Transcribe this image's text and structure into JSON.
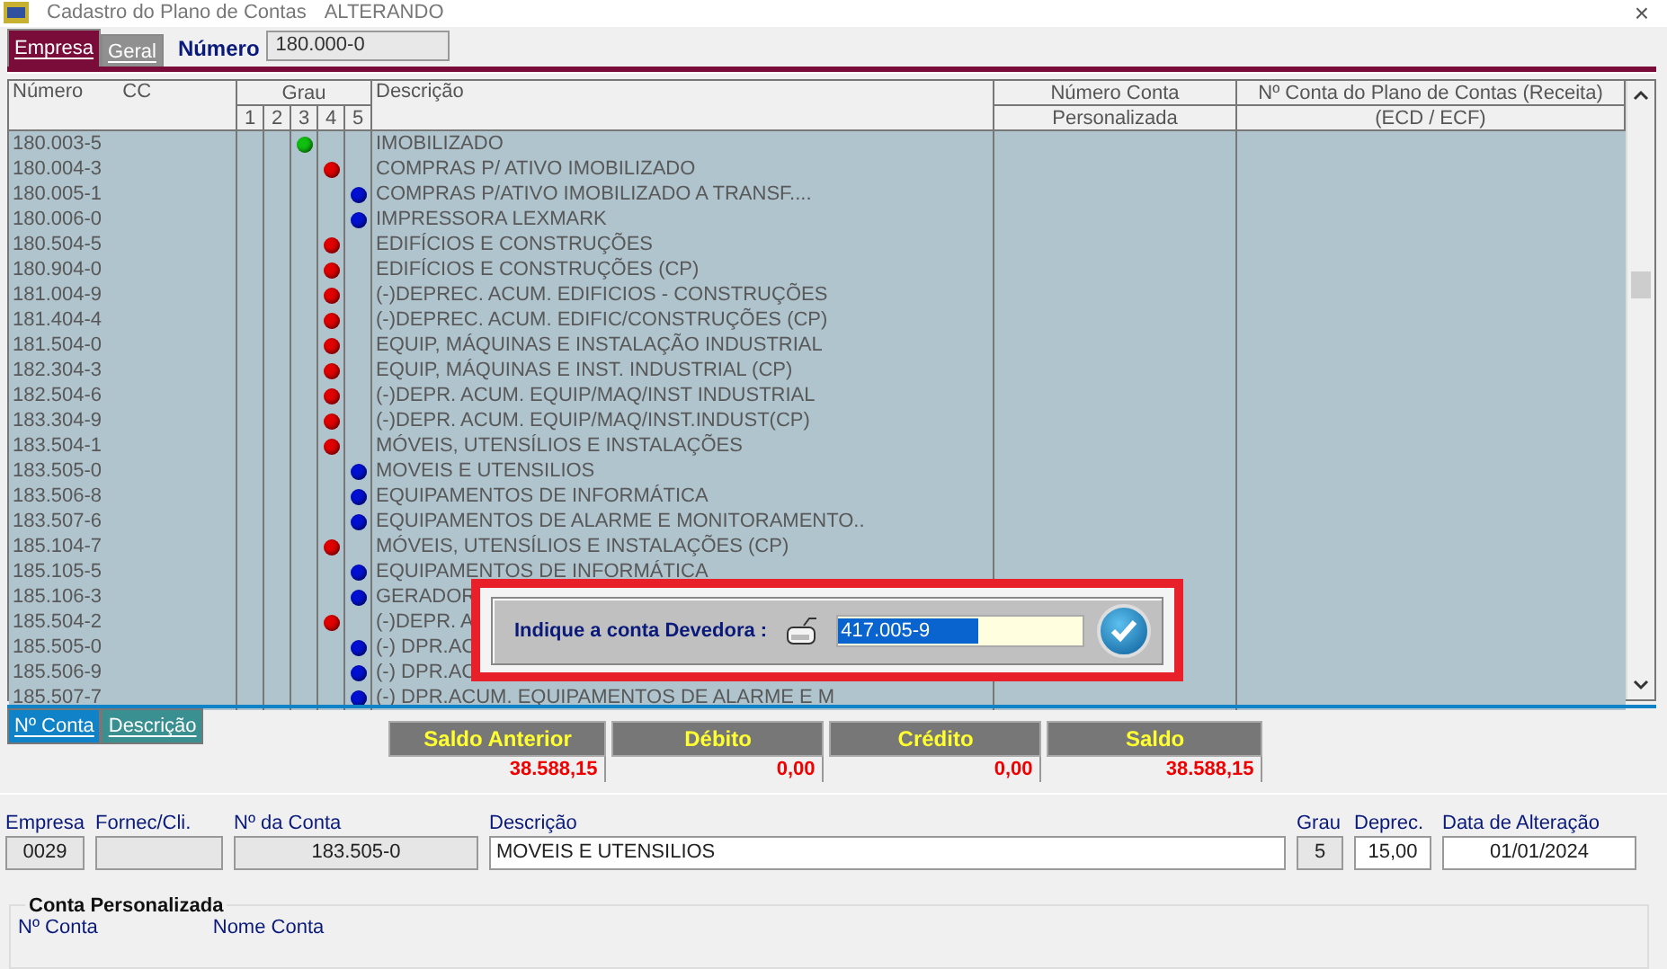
{
  "window": {
    "title": "Cadastro do Plano de Contas",
    "mode": "ALTERANDO",
    "close": "×"
  },
  "top_tabs": [
    {
      "label": "Empresa",
      "selected": true
    },
    {
      "label": "Geral",
      "selected": false
    }
  ],
  "numero": {
    "label": "Número",
    "value": "180.000-0"
  },
  "table": {
    "columns": {
      "numero": "Número",
      "cc": "CC",
      "grau": "Grau",
      "grau_levels": [
        "1",
        "2",
        "3",
        "4",
        "5"
      ],
      "descricao": "Descrição",
      "conta_1": "Número Conta",
      "conta_2": "Personalizada",
      "ecd_1": "Nº Conta do Plano de Contas (Receita)",
      "ecd_2": "(ECD / ECF)"
    },
    "rows": [
      {
        "numero": "180.003-5",
        "kind": "three",
        "color": "#10c010",
        "descricao": "IMOBILIZADO"
      },
      {
        "numero": "180.004-3",
        "kind": "four",
        "color": "#e00000",
        "descricao": "COMPRAS P/ ATIVO IMOBILIZADO"
      },
      {
        "numero": "180.005-1",
        "kind": "five",
        "color": "#0010d0",
        "descricao": "COMPRAS P/ATIVO IMOBILIZADO A TRANSF...."
      },
      {
        "numero": "180.006-0",
        "kind": "five",
        "color": "#0010d0",
        "descricao": "IMPRESSORA LEXMARK"
      },
      {
        "numero": "180.504-5",
        "kind": "four",
        "color": "#e00000",
        "descricao": "EDIFÍCIOS E CONSTRUÇÕES"
      },
      {
        "numero": "180.904-0",
        "kind": "four",
        "color": "#e00000",
        "descricao": "EDIFÍCIOS E CONSTRUÇÕES (CP)"
      },
      {
        "numero": "181.004-9",
        "kind": "four",
        "color": "#e00000",
        "descricao": "(-)DEPREC. ACUM. EDIFICIOS - CONSTRUÇÕES"
      },
      {
        "numero": "181.404-4",
        "kind": "four",
        "color": "#e00000",
        "descricao": "(-)DEPREC. ACUM. EDIFIC/CONSTRUÇÕES (CP)"
      },
      {
        "numero": "181.504-0",
        "kind": "four",
        "color": "#e00000",
        "descricao": "EQUIP, MÁQUINAS E INSTALAÇÃO INDUSTRIAL"
      },
      {
        "numero": "182.304-3",
        "kind": "four",
        "color": "#e00000",
        "descricao": "EQUIP, MÁQUINAS E INST. INDUSTRIAL (CP)"
      },
      {
        "numero": "182.504-6",
        "kind": "four",
        "color": "#e00000",
        "descricao": "(-)DEPR. ACUM. EQUIP/MAQ/INST INDUSTRIAL"
      },
      {
        "numero": "183.304-9",
        "kind": "four",
        "color": "#e00000",
        "descricao": "(-)DEPR. ACUM. EQUIP/MAQ/INST.INDUST(CP)"
      },
      {
        "numero": "183.504-1",
        "kind": "four",
        "color": "#e00000",
        "descricao": "MÓVEIS, UTENSÍLIOS E INSTALAÇÕES"
      },
      {
        "numero": "183.505-0",
        "kind": "five",
        "color": "#0010d0",
        "descricao": "MOVEIS E UTENSILIOS"
      },
      {
        "numero": "183.506-8",
        "kind": "five",
        "color": "#0010d0",
        "descricao": "EQUIPAMENTOS DE INFORMÁTICA"
      },
      {
        "numero": "183.507-6",
        "kind": "five",
        "color": "#0010d0",
        "descricao": "EQUIPAMENTOS DE ALARME E MONITORAMENTO.."
      },
      {
        "numero": "185.104-7",
        "kind": "four",
        "color": "#e00000",
        "descricao": "MÓVEIS, UTENSÍLIOS E INSTALAÇÕES (CP)"
      },
      {
        "numero": "185.105-5",
        "kind": "five",
        "color": "#0010d0",
        "descricao": "EQUIPAMENTOS DE INFORMÁTICA"
      },
      {
        "numero": "185.106-3",
        "kind": "five",
        "color": "#0010d0",
        "descricao": "GERADOR"
      },
      {
        "numero": "185.504-2",
        "kind": "four",
        "color": "#e00000",
        "descricao": "(-)DEPR. A"
      },
      {
        "numero": "185.505-0",
        "kind": "five",
        "color": "#0010d0",
        "descricao": "(-) DPR.AC"
      },
      {
        "numero": "185.506-9",
        "kind": "five",
        "color": "#0010d0",
        "descricao": "(-) DPR.AC"
      },
      {
        "numero": "185.507-7",
        "kind": "five",
        "color": "#0010d0",
        "descricao": "(-) DPR.ACUM. EQUIPAMENTOS DE ALARME E M"
      }
    ]
  },
  "dialog": {
    "label": "Indique a conta Devedora :",
    "value": "417.005-9"
  },
  "bottom_tabs": [
    {
      "label": "Nº Conta",
      "selected": true
    },
    {
      "label": "Descrição",
      "selected": false
    }
  ],
  "totals": [
    {
      "label": "Saldo Anterior",
      "value": "38.588,15"
    },
    {
      "label": "Débito",
      "value": "0,00"
    },
    {
      "label": "Crédito",
      "value": "0,00"
    },
    {
      "label": "Saldo",
      "value": "38.588,15"
    }
  ],
  "form": {
    "empresa": {
      "label": "Empresa",
      "value": "0029"
    },
    "fornec": {
      "label": "Fornec/Cli."
    },
    "conta": {
      "label": "Nº da Conta",
      "value": "183.505-0"
    },
    "descricao": {
      "label": "Descrição",
      "value": "MOVEIS E UTENSILIOS"
    },
    "grau": {
      "label": "Grau",
      "value": "5"
    },
    "deprec": {
      "label": "Deprec.",
      "value": "15,00"
    },
    "data": {
      "label": "Data de Alteração",
      "value": "01/01/2024"
    }
  },
  "personalizada": {
    "title": "Conta Personalizada",
    "conta_label": "Nº Conta",
    "nome_label": "Nome Conta"
  }
}
